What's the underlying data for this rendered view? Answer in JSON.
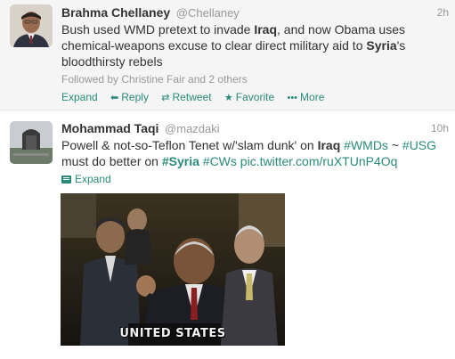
{
  "tweets": [
    {
      "fullname": "Brahma Chellaney",
      "username": "@Chellaney",
      "time": "2h",
      "text_parts": [
        "Bush used WMD pretext to invade ",
        "Iraq",
        ", and now Obama uses chemical-weapons excuse to clear direct military aid to ",
        "Syria",
        "'s bloodthirsty rebels"
      ],
      "followed_by": "Followed by Christine Fair and 2 others",
      "actions": {
        "expand": "Expand",
        "reply": "Reply",
        "retweet": "Retweet",
        "favorite": "Favorite",
        "more": "More"
      }
    },
    {
      "fullname": "Mohammad Taqi",
      "username": "@mazdaki",
      "time": "10h",
      "text_parts": [
        "Powell & not-so-Teflon Tenet w/'slam dunk' on ",
        "Iraq",
        " ",
        "#WMDs",
        " ~ ",
        "#USG",
        " must do better on ",
        "#Syria",
        " ",
        "#CWs",
        " ",
        "pic.twitter.com/ruXTUnP4Oq"
      ],
      "expand": "Expand",
      "media_caption": "UNITED STATES"
    }
  ],
  "colors": {
    "link": "#2a8a7a",
    "muted": "#999999",
    "text": "#333333"
  },
  "icons": {
    "reply": "reply-arrow-icon",
    "retweet": "retweet-icon",
    "favorite": "star-icon",
    "more": "more-dots-icon",
    "expand": "media-card-icon"
  }
}
